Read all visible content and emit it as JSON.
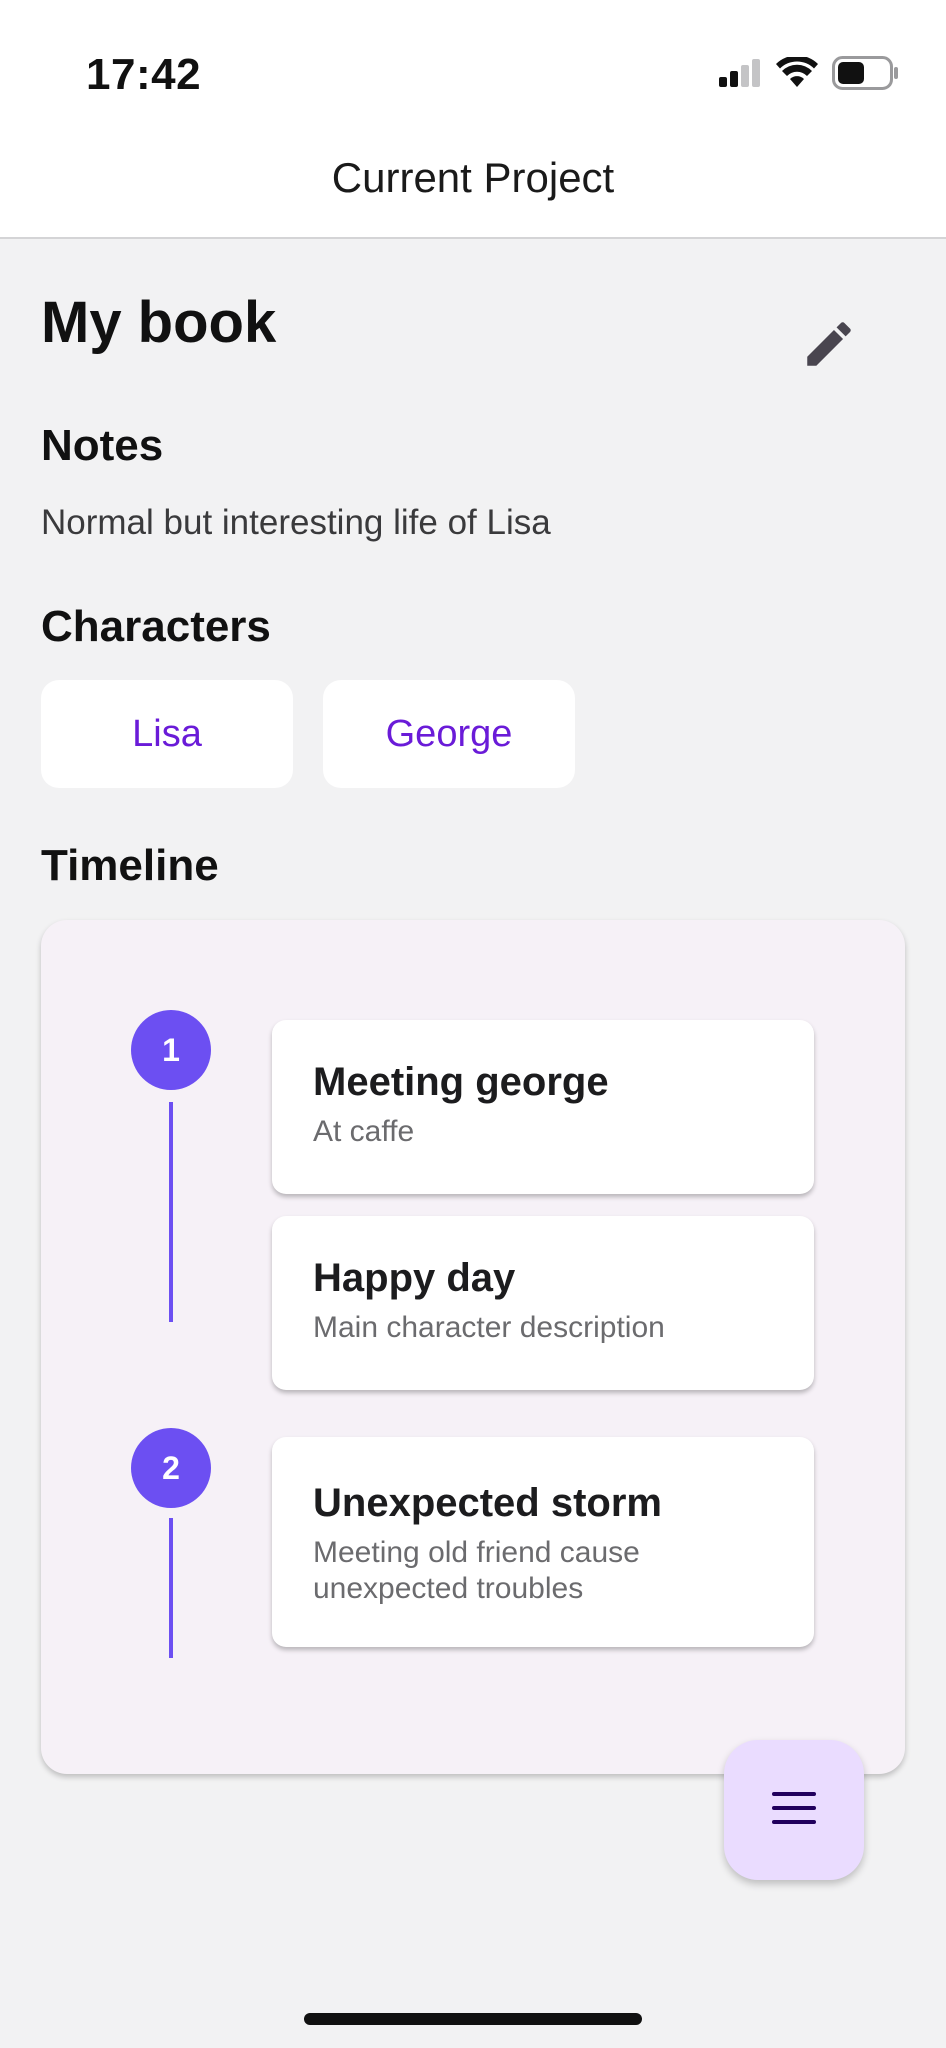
{
  "status_bar": {
    "time": "17:42",
    "icons": [
      "cellular-signal-icon",
      "wifi-icon",
      "battery-icon"
    ]
  },
  "header": {
    "title": "Current Project"
  },
  "project": {
    "title": "My book",
    "edit_icon": "pencil-icon"
  },
  "notes": {
    "heading": "Notes",
    "text": "Normal but interesting life of Lisa"
  },
  "characters": {
    "heading": "Characters",
    "items": [
      {
        "name": "Lisa"
      },
      {
        "name": "George"
      }
    ]
  },
  "timeline": {
    "heading": "Timeline",
    "steps": [
      {
        "number": "1",
        "events": [
          {
            "title": "Meeting george",
            "description": "At caffe"
          },
          {
            "title": "Happy day",
            "description": "Main character description"
          }
        ]
      },
      {
        "number": "2",
        "events": [
          {
            "title": "Unexpected storm",
            "description": "Meeting old friend cause unexpected troubles"
          }
        ]
      }
    ]
  },
  "fab": {
    "icon": "menu-icon"
  },
  "colors": {
    "accent": "#6c4ff2",
    "chip_text": "#6a1bd8",
    "fab_background": "#eadcff",
    "timeline_background": "#f6f1f7",
    "page_background": "#f2f2f3"
  }
}
